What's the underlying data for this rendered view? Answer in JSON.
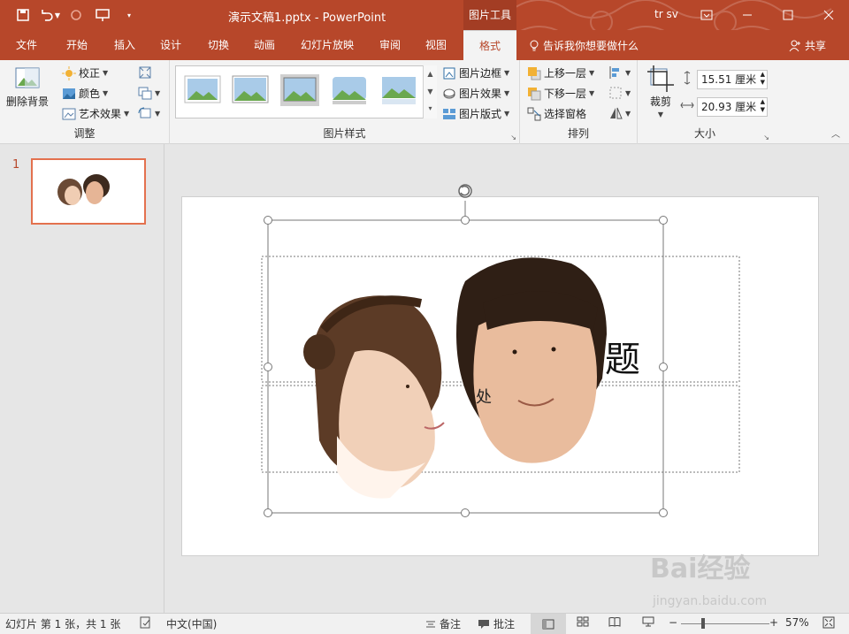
{
  "titlebar": {
    "title": "演示文稿1.pptx  -  PowerPoint",
    "context_tab": "图片工具",
    "user": "tr sv",
    "accent": "#b7472a"
  },
  "tabs": [
    {
      "label": "文件",
      "active": false
    },
    {
      "label": "开始",
      "active": false
    },
    {
      "label": "插入",
      "active": false
    },
    {
      "label": "设计",
      "active": false
    },
    {
      "label": "切换",
      "active": false
    },
    {
      "label": "动画",
      "active": false
    },
    {
      "label": "幻灯片放映",
      "active": false
    },
    {
      "label": "审阅",
      "active": false
    },
    {
      "label": "视图",
      "active": false
    },
    {
      "label": "格式",
      "active": true
    }
  ],
  "tell_me": "告诉我你想要做什么",
  "share": "共享",
  "ribbon": {
    "adjust": {
      "remove_bg": "删除背景",
      "correct": "校正",
      "color": "颜色",
      "art_effects": "艺术效果",
      "label": "调整"
    },
    "styles": {
      "border": "图片边框",
      "effects": "图片效果",
      "layout": "图片版式",
      "label": "图片样式"
    },
    "arrange": {
      "bring_forward": "上移一层",
      "send_backward": "下移一层",
      "selection_pane": "选择窗格",
      "label": "排列"
    },
    "size": {
      "crop": "裁剪",
      "height": "15.51 厘米",
      "width": "20.93 厘米",
      "label": "大小"
    }
  },
  "slide_pane": {
    "slide_number": "1"
  },
  "slide": {
    "title_text": "题",
    "subtitle_text": "处"
  },
  "statusbar": {
    "slide_info": "幻灯片 第 1 张，共 1 张",
    "language": "中文(中国)",
    "notes": "备注",
    "comments": "批注",
    "zoom": "57%"
  },
  "watermark": {
    "brand": "Bai经验",
    "url": "jingyan.baidu.com"
  }
}
